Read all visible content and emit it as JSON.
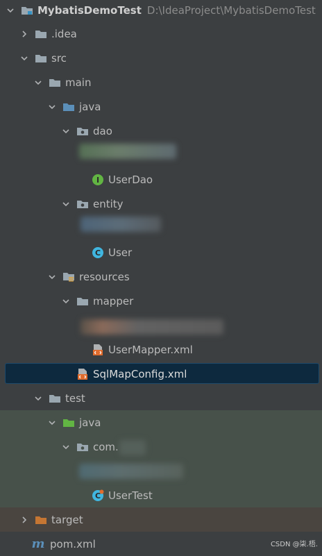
{
  "project": {
    "name": "MybatisDemoTest",
    "path": "D:\\IdeaProject\\MybatisDemoTest"
  },
  "tree": {
    "idea": ".idea",
    "src": "src",
    "main": "main",
    "main_java": "java",
    "dao": "dao",
    "user_dao": "UserDao",
    "entity": "entity",
    "user": "User",
    "resources": "resources",
    "mapper": "mapper",
    "user_mapper_xml": "UserMapper.xml",
    "sql_map_config": "SqlMapConfig.xml",
    "test": "test",
    "test_java": "java",
    "com": "com.",
    "user_test": "UserTest",
    "target": "target",
    "pom": "pom.xml"
  },
  "icons": {
    "pom": "m",
    "interface_letter": "I",
    "class_letter": "C"
  },
  "colors": {
    "background": "#3c3f41",
    "selection": "#0d293e",
    "test_band": "#47514a",
    "target_band": "#4a4540",
    "folder": "#9aa7b0",
    "java_source_folder": "#5b8fb9",
    "test_java_folder": "#62b543",
    "target_folder": "#c57633",
    "interface_icon": "#62b543",
    "class_icon": "#40b6e0",
    "xml_icon": "#e06c2e"
  },
  "watermark": "CSDN @柒.梧."
}
